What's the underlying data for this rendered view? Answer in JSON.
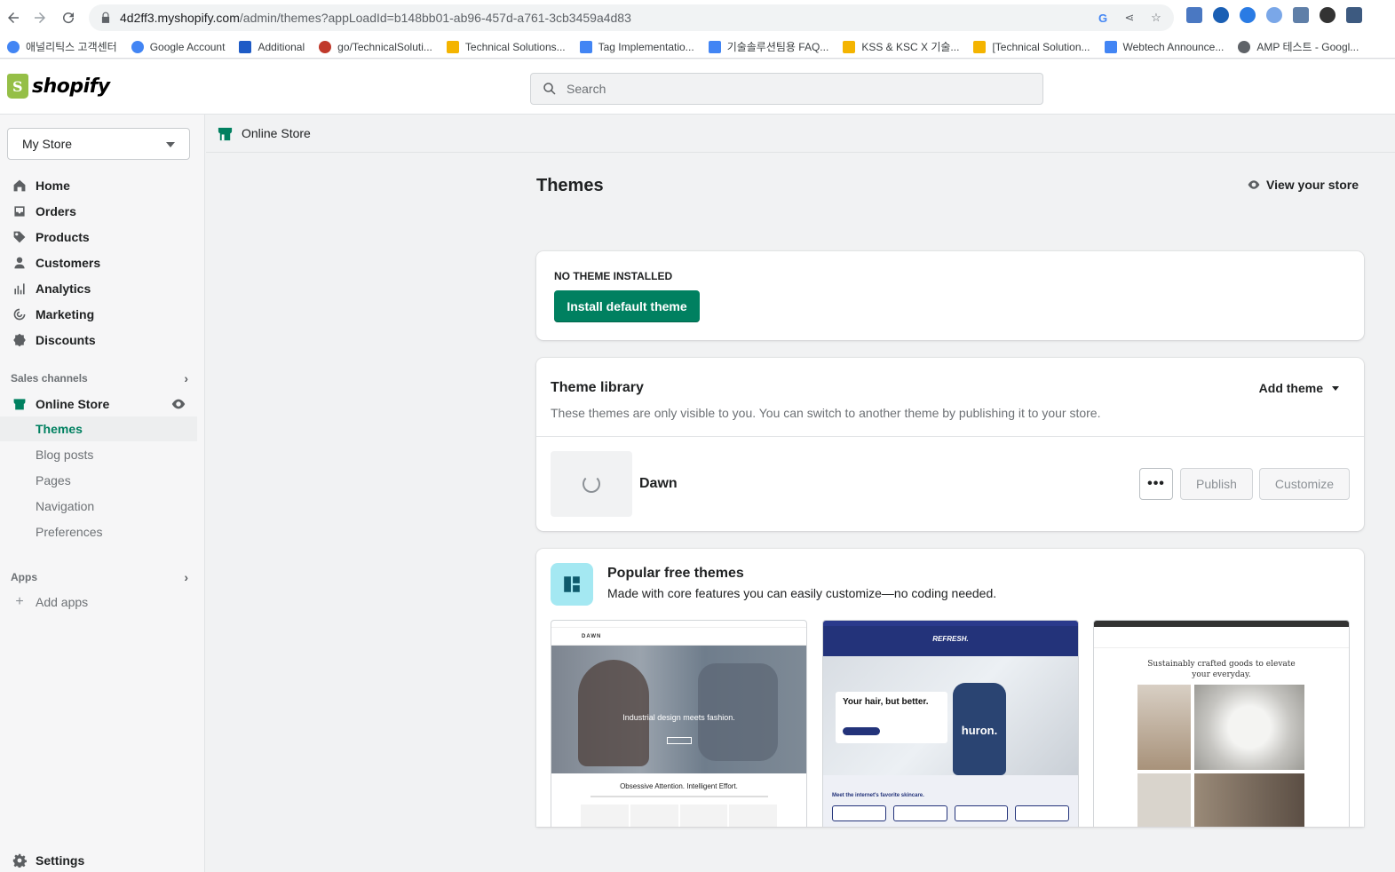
{
  "browser": {
    "url_host": "4d2ff3.myshopify.com",
    "url_path": "/admin/themes?appLoadId=b148bb01-ab96-457d-a761-3cb3459a4d83",
    "bookmarks": [
      {
        "label": "애널리틱스 고객센터",
        "color": "#4285f4"
      },
      {
        "label": "Google Account",
        "color": "#4285f4"
      },
      {
        "label": "Additional",
        "color": "#1e5bc6"
      },
      {
        "label": "go/TechnicalSoluti...",
        "color": "#c0392b"
      },
      {
        "label": "Technical Solutions...",
        "color": "#f4b400"
      },
      {
        "label": "Tag Implementatio...",
        "color": "#4285f4"
      },
      {
        "label": "기술솔루션팀용 FAQ...",
        "color": "#4285f4"
      },
      {
        "label": "KSS & KSC X 기술...",
        "color": "#f4b400"
      },
      {
        "label": "[Technical Solution...",
        "color": "#f4b400"
      },
      {
        "label": "Webtech Announce...",
        "color": "#4285f4"
      },
      {
        "label": "AMP 테스트 - Googl...",
        "color": "#5f6368"
      }
    ]
  },
  "header": {
    "logo_text": "shopify",
    "search_placeholder": "Search"
  },
  "sidebar": {
    "store_name": "My Store",
    "main_items": [
      {
        "label": "Home",
        "icon": "home-icon"
      },
      {
        "label": "Orders",
        "icon": "orders-icon"
      },
      {
        "label": "Products",
        "icon": "tag-icon"
      },
      {
        "label": "Customers",
        "icon": "person-icon"
      },
      {
        "label": "Analytics",
        "icon": "bar-chart-icon"
      },
      {
        "label": "Marketing",
        "icon": "target-icon"
      },
      {
        "label": "Discounts",
        "icon": "discount-icon"
      }
    ],
    "sales_channels_label": "Sales channels",
    "online_store_label": "Online Store",
    "sub_items": [
      "Themes",
      "Blog posts",
      "Pages",
      "Navigation",
      "Preferences"
    ],
    "apps_label": "Apps",
    "add_apps_label": "Add apps",
    "settings_label": "Settings"
  },
  "breadcrumb": {
    "label": "Online Store"
  },
  "main": {
    "title": "Themes",
    "view_store_label": "View your store",
    "no_theme": {
      "heading": "NO THEME INSTALLED",
      "button_label": "Install default theme"
    },
    "library": {
      "title": "Theme library",
      "description": "These themes are only visible to you. You can switch to another theme by publishing it to your store.",
      "add_theme_label": "Add theme",
      "theme_name": "Dawn",
      "more_label": "•••",
      "publish_label": "Publish",
      "customize_label": "Customize"
    },
    "popular": {
      "title": "Popular free themes",
      "subtitle": "Made with core features you can easily customize—no coding needed.",
      "dawn_brand": "DAWN",
      "dawn_hero": "Industrial design meets fashion.",
      "dawn_tagline": "Obsessive Attention. Intelligent Effort.",
      "refresh_brand": "REFRESH.",
      "refresh_hero": "Your hair, but better.",
      "refresh_bottle": "huron.",
      "refresh_section": "Meet the internet's favorite skincare.",
      "craft_tagline": "Sustainably crafted goods to elevate your everyday."
    }
  },
  "colors": {
    "primary_green": "#008060",
    "popular_icon_bg": "#a4e8f2"
  }
}
